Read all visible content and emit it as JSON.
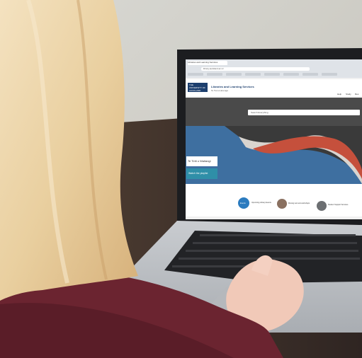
{
  "browser": {
    "tab_label": "Libraries and Learning Services",
    "url": "library.auckland.ac.nz"
  },
  "site": {
    "logo_text": "THE UNIVERSITY OF AUCKLAND",
    "title": "Libraries and Learning Services",
    "subtitle": "Te Tumu Herenga",
    "nav": [
      "Help",
      "Study",
      "Res"
    ]
  },
  "search": {
    "placeholder": "Search Everything"
  },
  "hero": {
    "card_text": "Te Tiriti o Waitangi",
    "button_label": "Watch the playlist"
  },
  "strip": {
    "badge": "Events",
    "items": [
      "Upcoming Library Events",
      "Moving text and workshops",
      "Student Support Services"
    ]
  },
  "colors": {
    "brand_navy": "#1d3f6e",
    "hero_blue": "#3e6fa0",
    "teal_button": "#2f8fa8",
    "sweater_maroon": "#6b2430"
  },
  "icons": [
    "laptop-icon"
  ]
}
